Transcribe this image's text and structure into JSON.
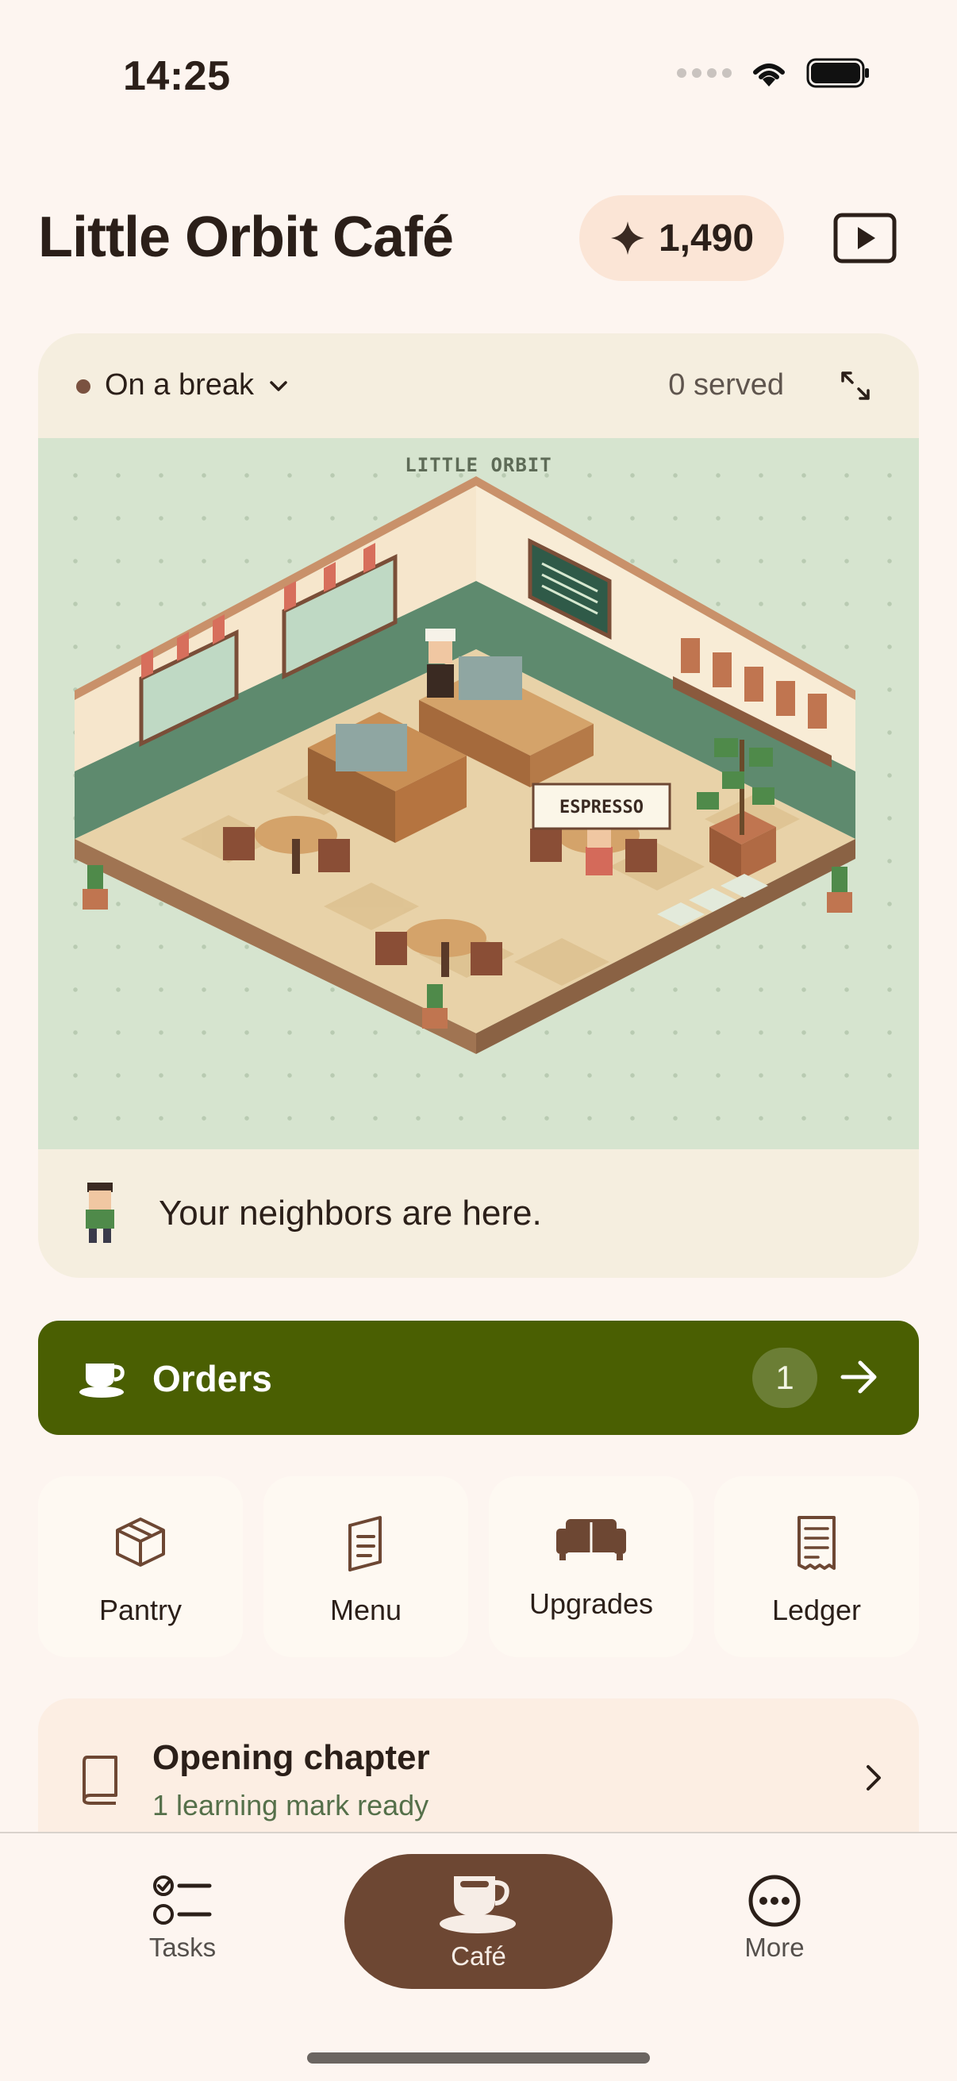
{
  "status_bar": {
    "time": "14:25"
  },
  "header": {
    "title": "Little Orbit Café",
    "coins": "1,490"
  },
  "cafe_card": {
    "status": "On a break",
    "served": "0 served",
    "scene_label": "LITTLE ORBIT",
    "sign_text": "ESPRESSO",
    "neighbors_text": "Your neighbors are here."
  },
  "orders": {
    "label": "Orders",
    "count": "1"
  },
  "tiles": [
    {
      "label": "Pantry",
      "icon": "box-icon"
    },
    {
      "label": "Menu",
      "icon": "menu-book-icon"
    },
    {
      "label": "Upgrades",
      "icon": "sofa-icon"
    },
    {
      "label": "Ledger",
      "icon": "receipt-icon"
    }
  ],
  "chapter": {
    "title": "Opening chapter",
    "subtitle": "1 learning mark ready"
  },
  "tabbar": {
    "tabs": [
      {
        "label": "Tasks",
        "icon": "checklist-icon"
      },
      {
        "label": "Café",
        "icon": "coffee-cup-icon",
        "active": true
      },
      {
        "label": "More",
        "icon": "more-dots-icon"
      }
    ]
  },
  "colors": {
    "accent": "#4A5F02",
    "brand": "#6D4733",
    "background": "#FDF5F0"
  }
}
